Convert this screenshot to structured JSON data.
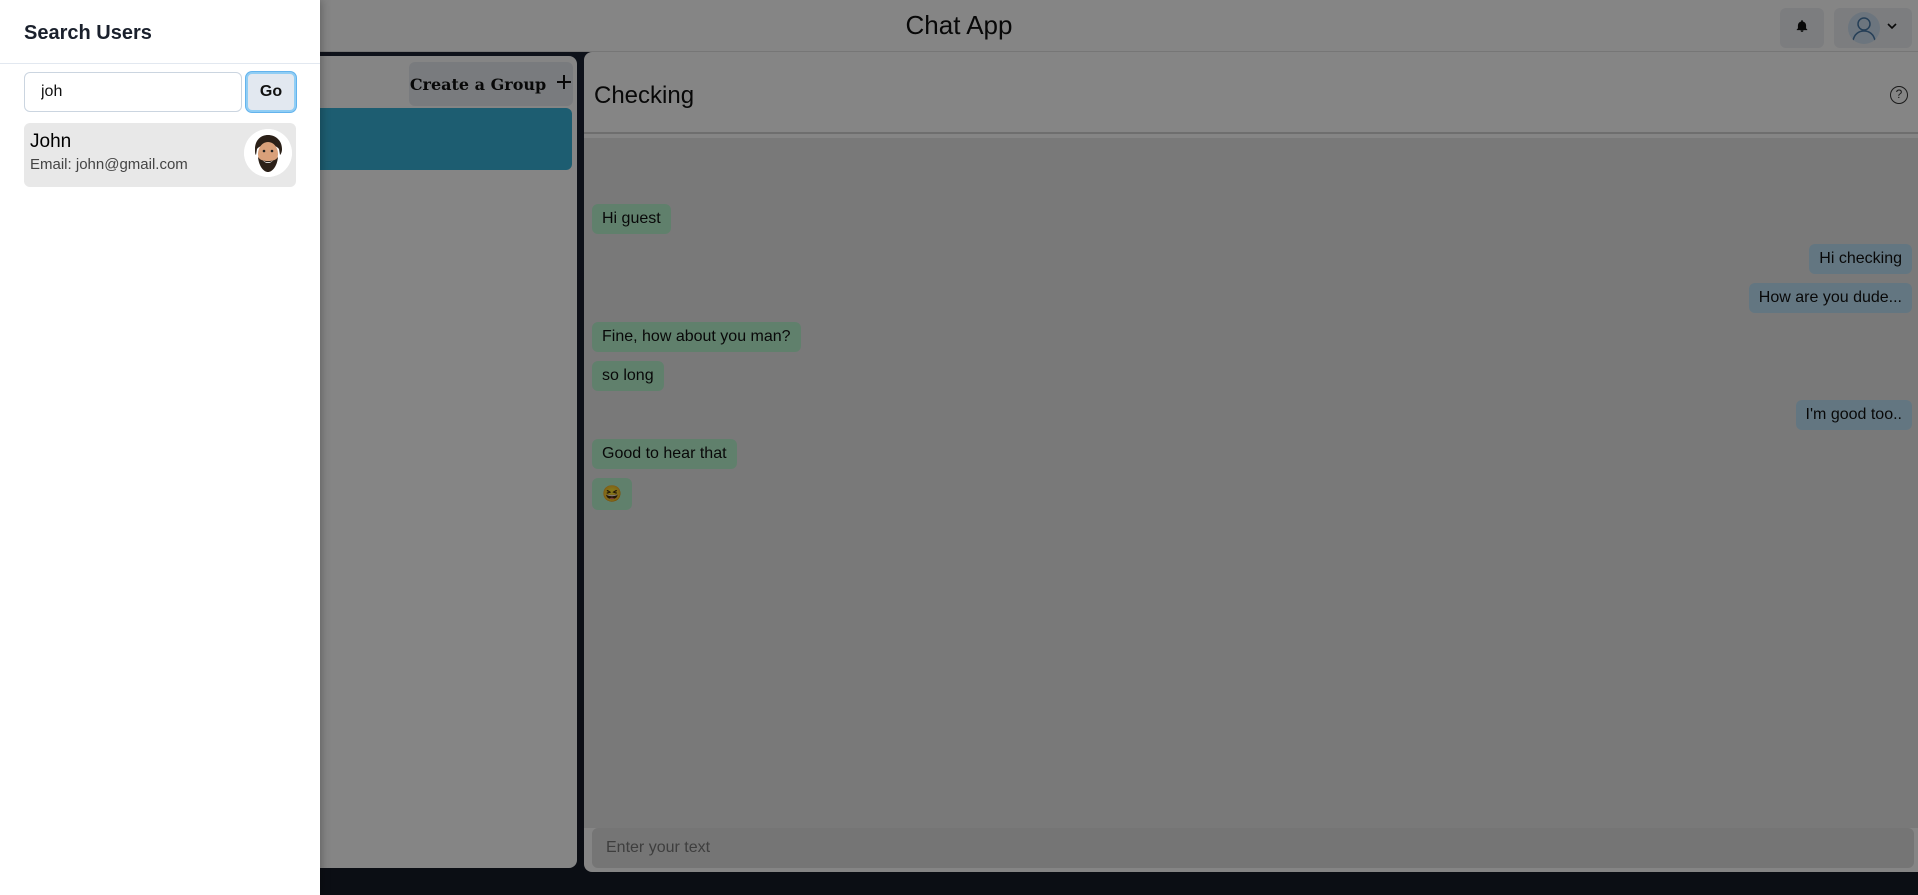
{
  "app": {
    "title": "Chat App"
  },
  "header": {
    "notification_icon": "bell-icon",
    "profile_icon": "user-avatar-icon",
    "profile_menu_icon": "chevron-down-icon"
  },
  "left_panel": {
    "create_group_label": "Create a Group",
    "create_group_icon": "plus-icon"
  },
  "chat": {
    "title": "Checking",
    "help_icon": "question-circle-icon",
    "messages": [
      {
        "side": "in",
        "text": "Hi guest"
      },
      {
        "side": "out",
        "text": "Hi checking"
      },
      {
        "side": "out",
        "text": "How are you dude..."
      },
      {
        "side": "in",
        "text": "Fine, how about you man?"
      },
      {
        "side": "in",
        "text": "so long"
      },
      {
        "side": "out",
        "text": "I'm good too.."
      },
      {
        "side": "in",
        "text": "Good to hear that"
      },
      {
        "side": "in",
        "text": "😆"
      }
    ],
    "input_placeholder": "Enter your text"
  },
  "drawer": {
    "title": "Search Users",
    "search_value": "joh",
    "go_label": "Go",
    "results": [
      {
        "name": "John",
        "email_label": "Email:",
        "email": "john@gmail.com"
      }
    ]
  },
  "colors": {
    "incoming_bubble": "#b9f5d0",
    "outgoing_bubble": "#bee3f8",
    "selected_chat": "#38b2d8",
    "result_card": "#e8e8e8"
  }
}
